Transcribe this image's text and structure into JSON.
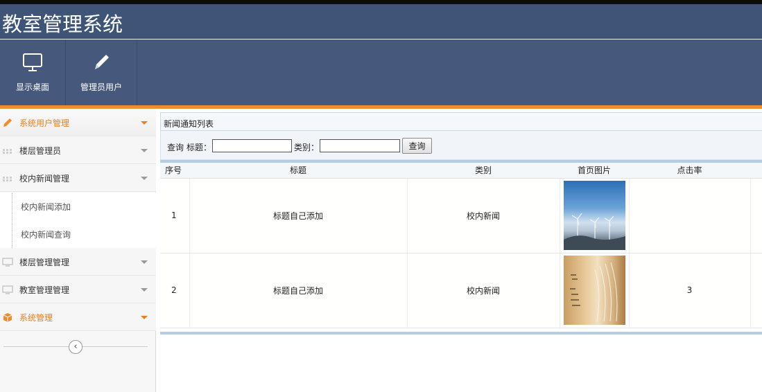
{
  "app": {
    "title": "教室管理系统"
  },
  "toolbar": {
    "items": [
      {
        "label": "显示桌面",
        "icon": "monitor-icon"
      },
      {
        "label": "管理员用户",
        "icon": "pencil-icon"
      }
    ]
  },
  "sidebar": {
    "items": [
      {
        "label": "系统用户管理",
        "icon": "pencil-icon",
        "state": "active"
      },
      {
        "label": "楼层管理员",
        "icon": "grid-icon"
      },
      {
        "label": "校内新闻管理",
        "icon": "grid-icon",
        "state": "expanded"
      },
      {
        "label": "楼层管理管理",
        "icon": "monitor-icon"
      },
      {
        "label": "教室管理管理",
        "icon": "monitor-icon"
      },
      {
        "label": "系统管理",
        "icon": "box-icon",
        "state": "highlight"
      }
    ],
    "subitems": [
      {
        "label": "校内新闻添加"
      },
      {
        "label": "校内新闻查询"
      }
    ],
    "collapse_label": "‹"
  },
  "panel": {
    "title": "新闻通知列表"
  },
  "search": {
    "prefix": "查询",
    "title_label": "标题：",
    "title_value": "",
    "category_label": "类别：",
    "category_value": "",
    "button_label": "查询"
  },
  "table": {
    "headers": [
      "序号",
      "标题",
      "类别",
      "首页图片",
      "点击率"
    ],
    "rows": [
      {
        "id": "1",
        "title": "标题自己添加",
        "category": "校内新闻",
        "image": "wind-turbines-image",
        "clicks": ""
      },
      {
        "id": "2",
        "title": "标题自己添加",
        "category": "校内新闻",
        "image": "open-book-image",
        "clicks": "3"
      }
    ]
  },
  "colors": {
    "header_bg": "#3f5578",
    "toolbar_bg": "#46597c",
    "accent_orange": "#ef8c2b",
    "table_border": "#b4cde6"
  }
}
